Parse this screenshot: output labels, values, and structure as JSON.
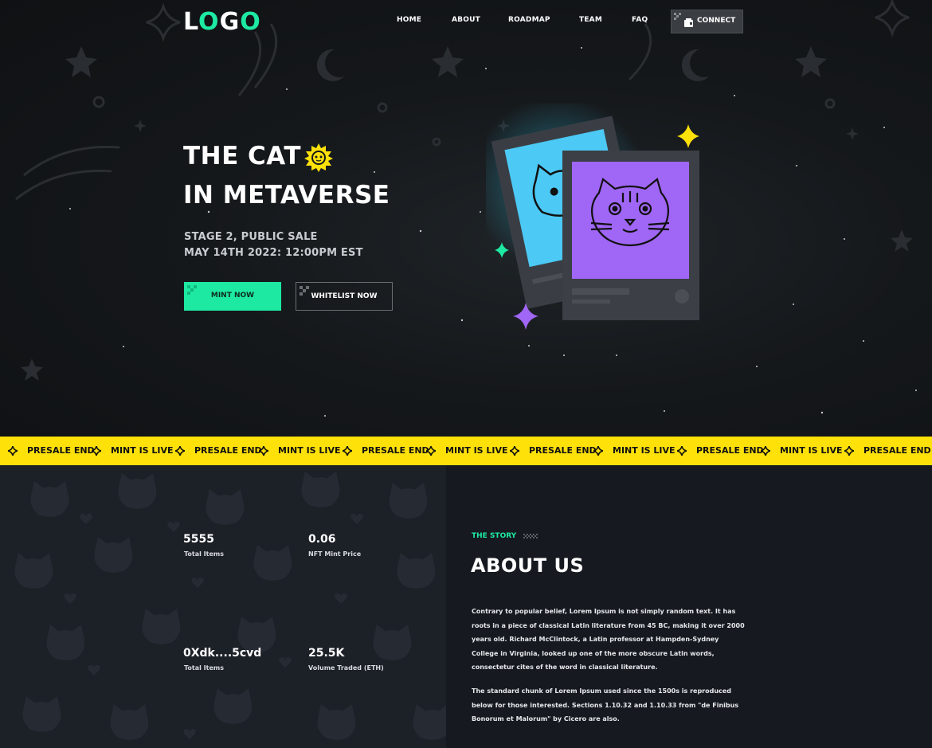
{
  "logo": {
    "part1": "L",
    "part2": "O",
    "part3": "G",
    "part4": "O"
  },
  "nav": [
    {
      "label": "HOME"
    },
    {
      "label": "ABOUT"
    },
    {
      "label": "ROADMAP"
    },
    {
      "label": "TEAM"
    },
    {
      "label": "FAQ"
    }
  ],
  "connect_label": "CONNECT",
  "hero": {
    "title_line1": "THE CAT",
    "title_line2": "IN METAVERSE",
    "stage": "STAGE 2, PUBLIC SALE",
    "date": "MAY 14TH 2022: 12:00PM EST",
    "mint_label": "MINT NOW",
    "whitelist_label": "WHITELIST NOW"
  },
  "ticker": [
    "PRESALE END",
    "MINT IS LIVE",
    "PRESALE END",
    "MINT IS LIVE",
    "PRESALE END",
    "MINT IS LIVE",
    "PRESALE END",
    "MINT IS LIVE",
    "PRESALE END",
    "MINT IS LIVE",
    "PRESALE END"
  ],
  "stats": [
    {
      "value": "5555",
      "label": "Total Items"
    },
    {
      "value": "0.06",
      "label": "NFT Mint Price"
    },
    {
      "value": "0Xdk....5cvd",
      "label": "Total Items"
    },
    {
      "value": "25.5K",
      "label": "Volume Traded (ETH)"
    }
  ],
  "about": {
    "kicker": "THE STORY",
    "title": "ABOUT US",
    "para1_lines": [
      "Contrary to popular belief, Lorem Ipsum is not simply random text. It has",
      "roots in a piece of classical Latin literature from 45 BC, making it over 2000",
      "years old. Richard McClintock, a Latin professor at Hampden-Sydney",
      "College in Virginia, looked up one of the more obscure Latin words,",
      "consectetur cites of the word in classical literature."
    ],
    "para2_lines": [
      "The standard chunk of Lorem Ipsum used since the 1500s is reproduced",
      "below for those interested. Sections 1.10.32 and 1.10.33 from \"de Finibus",
      "Bonorum et Malorum\" by Cicero are also."
    ]
  },
  "colors": {
    "accent": "#1de9a2",
    "ticker": "#ffe10a",
    "card_blue": "#4cc9f5",
    "card_purple": "#a066f5"
  }
}
